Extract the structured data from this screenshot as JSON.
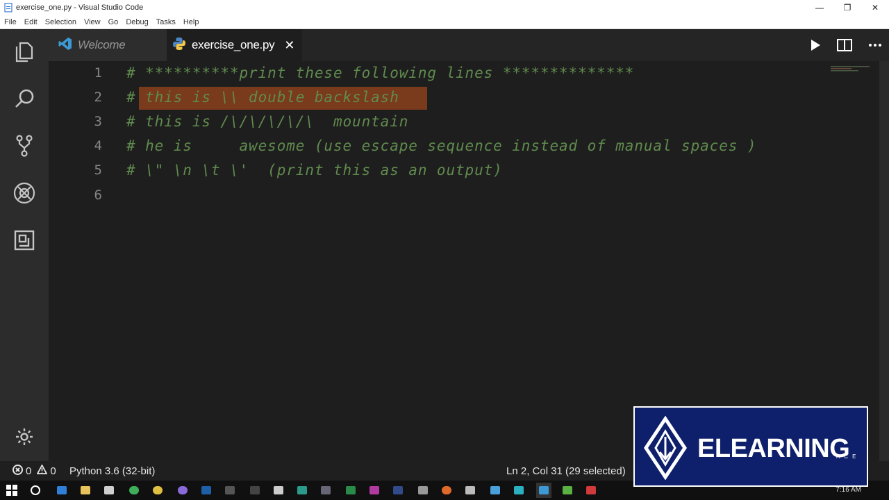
{
  "window": {
    "title": "exercise_one.py - Visual Studio Code",
    "controls": [
      "—",
      "❐",
      "✕"
    ]
  },
  "menu": [
    "File",
    "Edit",
    "Selection",
    "View",
    "Go",
    "Debug",
    "Tasks",
    "Help"
  ],
  "tabs": [
    {
      "label": "Welcome",
      "active": false,
      "icon": "vscode-icon"
    },
    {
      "label": "exercise_one.py",
      "active": true,
      "icon": "python-icon",
      "close": "✕"
    }
  ],
  "editor": {
    "lines": [
      {
        "number": "1",
        "text": "# **********print these following lines **************"
      },
      {
        "number": "2",
        "text": "# this is \\\\ double backslash"
      },
      {
        "number": "3",
        "text": "# this is /\\/\\/\\/\\/\\  mountain"
      },
      {
        "number": "4",
        "text": "# he is     awesome (use escape sequence instead of manual spaces )"
      },
      {
        "number": "5",
        "text": "# \\\" \\n \\t \\'  (print this as an output)"
      },
      {
        "number": "6",
        "text": ""
      }
    ],
    "comment_color": "#608b4e",
    "selection_color": "#7a3a1c"
  },
  "status": {
    "errors": "0",
    "warnings": "0",
    "interpreter": "Python 3.6 (32-bit)",
    "cursor": "Ln 2, Col 31 (29 selected)"
  },
  "taskbar": {
    "clock": "7:16 AM"
  },
  "watermark": {
    "text": "ELEARNING",
    "suffix": "A C E"
  }
}
